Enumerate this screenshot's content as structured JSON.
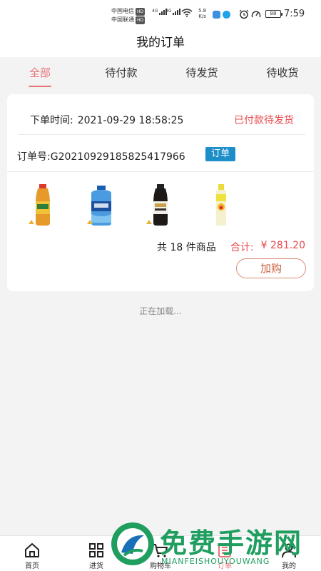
{
  "status_bar": {
    "carrier1": "中国电信",
    "carrier2": "中国联通",
    "hd": "HD",
    "net_type": "4G",
    "net_speed": "5.8",
    "net_speed_unit": "K/s",
    "battery": "88",
    "time": "7:59"
  },
  "header": {
    "title": "我的订单"
  },
  "tabs": [
    {
      "label": "全部"
    },
    {
      "label": "待付款"
    },
    {
      "label": "待发货"
    },
    {
      "label": "待收货"
    }
  ],
  "order": {
    "time_label": "下单时间:",
    "time": "2021-09-29 18:58:25",
    "status": "已付款待发货",
    "number": "订单号:G202109291858254179​66",
    "tag": "订单",
    "count_text": "共 18 件商品",
    "total_label": "合计:",
    "total": "¥ 281.20",
    "rebuy_label": "加购"
  },
  "loading_text": "正在加载...",
  "bottom_nav": [
    {
      "label": "首页"
    },
    {
      "label": "进货"
    },
    {
      "label": "购物车"
    },
    {
      "label": "订单"
    },
    {
      "label": "我的"
    }
  ],
  "watermark": {
    "text": "免费手游网",
    "sub": "MIANFEISHOUYOUWANG"
  },
  "colors": {
    "accent": "#e8737a",
    "price": "#e8484d",
    "tag": "#1e8ec9",
    "watermark": "#1f9e60"
  }
}
